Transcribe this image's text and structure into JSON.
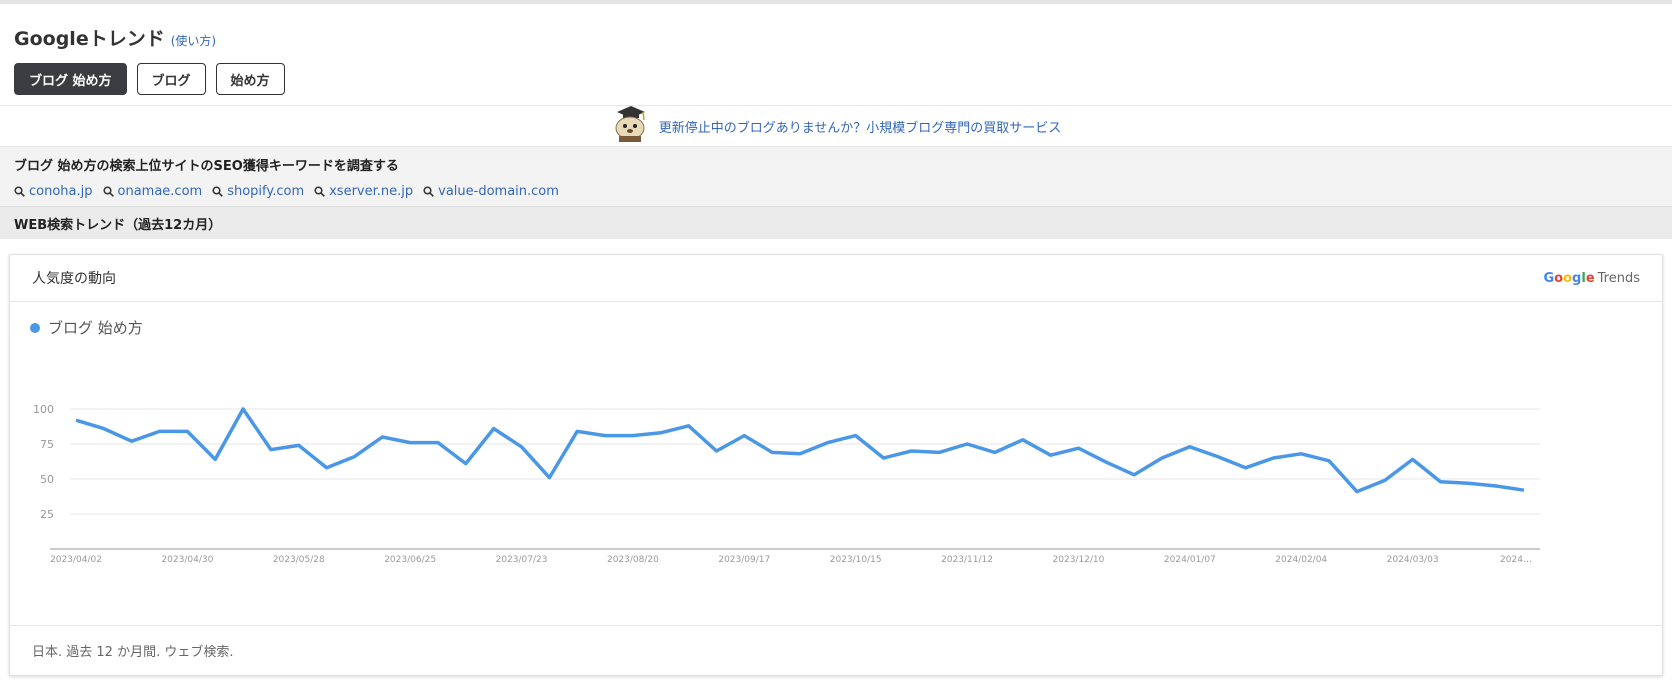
{
  "header": {
    "title": "Googleトレンド",
    "help_link": "(使い方)",
    "chips": [
      {
        "label": "ブログ 始め方",
        "active": true
      },
      {
        "label": "ブログ",
        "active": false
      },
      {
        "label": "始め方",
        "active": false
      }
    ]
  },
  "promo": {
    "text": "更新停止中のブログありませんか？小規模ブログ専門の買取サービス"
  },
  "seo": {
    "title": "ブログ 始め方の検索上位サイトのSEO獲得キーワードを調査する",
    "sites": [
      "conoha.jp",
      "onamae.com",
      "shopify.com",
      "xserver.ne.jp",
      "value-domain.com"
    ]
  },
  "trend_section": {
    "heading": "WEB検索トレンド（過去12カ月）"
  },
  "card": {
    "title": "人気度の動向",
    "logo_google": "Google",
    "logo_trends": "Trends",
    "footer": "日本. 過去 12 か月間. ウェブ検索."
  },
  "colors": {
    "series": "#4a97e8",
    "chip_active": "#3a3c42",
    "link": "#3367b8"
  },
  "chart_data": {
    "type": "line",
    "series": [
      {
        "name": "ブログ 始め方",
        "values": [
          92,
          86,
          77,
          84,
          84,
          64,
          100,
          71,
          74,
          58,
          66,
          80,
          76,
          76,
          61,
          86,
          73,
          51,
          84,
          81,
          81,
          83,
          88,
          70,
          81,
          69,
          68,
          76,
          81,
          65,
          70,
          69,
          75,
          69,
          78,
          67,
          72,
          62,
          53,
          65,
          73,
          66,
          58,
          65,
          68,
          63,
          41,
          49,
          64,
          48,
          47,
          45,
          42
        ]
      }
    ],
    "x_tick_labels": [
      "2023/04/02",
      "2023/04/30",
      "2023/05/28",
      "2023/06/25",
      "2023/07/23",
      "2023/08/20",
      "2023/09/17",
      "2023/10/15",
      "2023/11/12",
      "2023/12/10",
      "2024/01/07",
      "2024/02/04",
      "2024/03/03",
      "2024…"
    ],
    "y_ticks": [
      25,
      50,
      75,
      100
    ],
    "ylim": [
      0,
      100
    ],
    "grid": true
  }
}
